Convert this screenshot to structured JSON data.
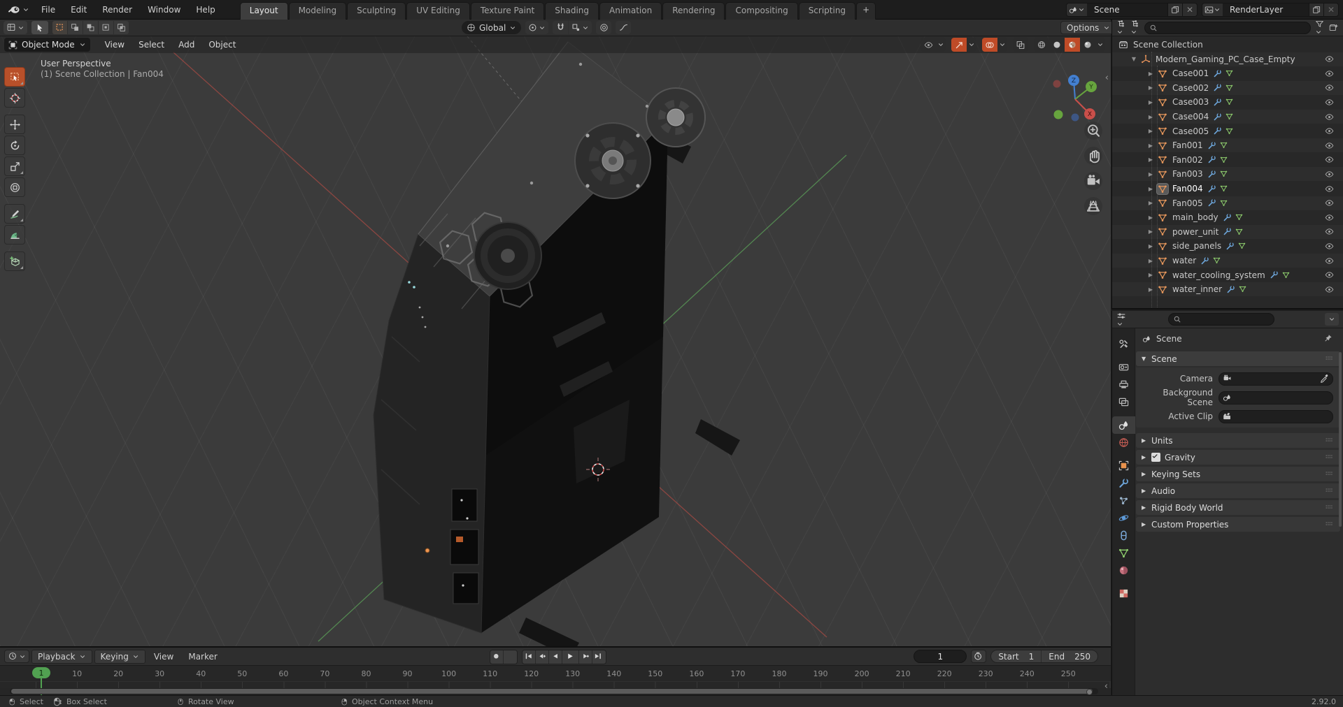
{
  "topbar": {
    "menus": [
      "File",
      "Edit",
      "Render",
      "Window",
      "Help"
    ],
    "workspaces": [
      "Layout",
      "Modeling",
      "Sculpting",
      "UV Editing",
      "Texture Paint",
      "Shading",
      "Animation",
      "Rendering",
      "Compositing",
      "Scripting"
    ],
    "active_workspace": "Layout",
    "add_workspace_label": "+",
    "scene_name": "Scene",
    "render_layer_name": "RenderLayer"
  },
  "tool_settings": {
    "orientation": "Global",
    "options_label": "Options"
  },
  "viewport": {
    "mode": "Object Mode",
    "menus": [
      "View",
      "Select",
      "Add",
      "Object"
    ],
    "overlay_line1": "User Perspective",
    "overlay_line2": "(1) Scene Collection | Fan004",
    "gizmo_axes": {
      "x": "X",
      "y": "Y",
      "z": "Z"
    },
    "tools": [
      "select-box",
      "cursor",
      "move",
      "rotate",
      "scale",
      "transform",
      "annotate",
      "measure",
      "add-cube"
    ],
    "nav_icons": [
      "zoom-icon",
      "pan-hand-icon",
      "camera-view-icon",
      "orthographic-grid-icon"
    ]
  },
  "outliner": {
    "search_value": "",
    "root": "Scene Collection",
    "collection": "Modern_Gaming_PC_Case_Empty",
    "items": [
      "Case001",
      "Case002",
      "Case003",
      "Case004",
      "Case005",
      "Fan001",
      "Fan002",
      "Fan003",
      "Fan004",
      "Fan005",
      "main_body",
      "power_unit",
      "side_panels",
      "water",
      "water_cooling_system",
      "water_inner"
    ],
    "selected_item": "Fan004"
  },
  "properties": {
    "search_value": "",
    "breadcrumb": "Scene",
    "scene_section": {
      "title": "Scene",
      "fields": [
        {
          "label": "Camera",
          "icon": "camera",
          "eyedropper": true
        },
        {
          "label": "Background Scene",
          "icon": "scene",
          "eyedropper": false
        },
        {
          "label": "Active Clip",
          "icon": "clip",
          "eyedropper": false
        }
      ]
    },
    "collapsed_sections": [
      {
        "label": "Units",
        "checkbox": false,
        "checked": false
      },
      {
        "label": "Gravity",
        "checkbox": true,
        "checked": true
      },
      {
        "label": "Keying Sets",
        "checkbox": false,
        "checked": false
      },
      {
        "label": "Audio",
        "checkbox": false,
        "checked": false
      },
      {
        "label": "Rigid Body World",
        "checkbox": false,
        "checked": false
      },
      {
        "label": "Custom Properties",
        "checkbox": false,
        "checked": false
      }
    ],
    "tabs": [
      "tool",
      "render",
      "output",
      "view-layer",
      "scene",
      "world",
      "object",
      "modifiers",
      "particles",
      "physics",
      "constraints",
      "object-data",
      "material",
      "texture"
    ],
    "active_tab": "scene"
  },
  "timeline": {
    "dropdown_menus": [
      "Playback",
      "Keying"
    ],
    "menus": [
      "View",
      "Marker"
    ],
    "transport": [
      "jump-to-start",
      "prev-keyframe",
      "play-reverse",
      "play",
      "next-keyframe",
      "jump-to-end"
    ],
    "current_frame": "1",
    "start_label": "Start",
    "start_value": "1",
    "end_label": "End",
    "end_value": "250",
    "ticks": [
      10,
      20,
      30,
      40,
      50,
      60,
      70,
      80,
      90,
      100,
      110,
      120,
      130,
      140,
      150,
      160,
      170,
      180,
      190,
      200,
      210,
      220,
      230,
      240,
      250
    ]
  },
  "statusbar": {
    "items": [
      {
        "icon": "mouse-left-icon",
        "label": "Select"
      },
      {
        "icon": "mouse-drag-icon",
        "label": "Box Select"
      },
      {
        "icon": "mouse-middle-icon",
        "label": "Rotate View"
      },
      {
        "icon": "mouse-right-icon",
        "label": "Object Context Menu"
      }
    ],
    "version": "2.92.0"
  },
  "colors": {
    "toggle_active": "#bf4b27",
    "tool_active": "#b8502a",
    "frame_marker_green": "#51a151",
    "axis_x": "#c94f4a",
    "axis_y": "#67a43e",
    "axis_z": "#437fd0",
    "mesh_icon_orange": "#e8985c",
    "modifier_blue": "#6ea7dc",
    "data_green": "#8fce6e"
  }
}
